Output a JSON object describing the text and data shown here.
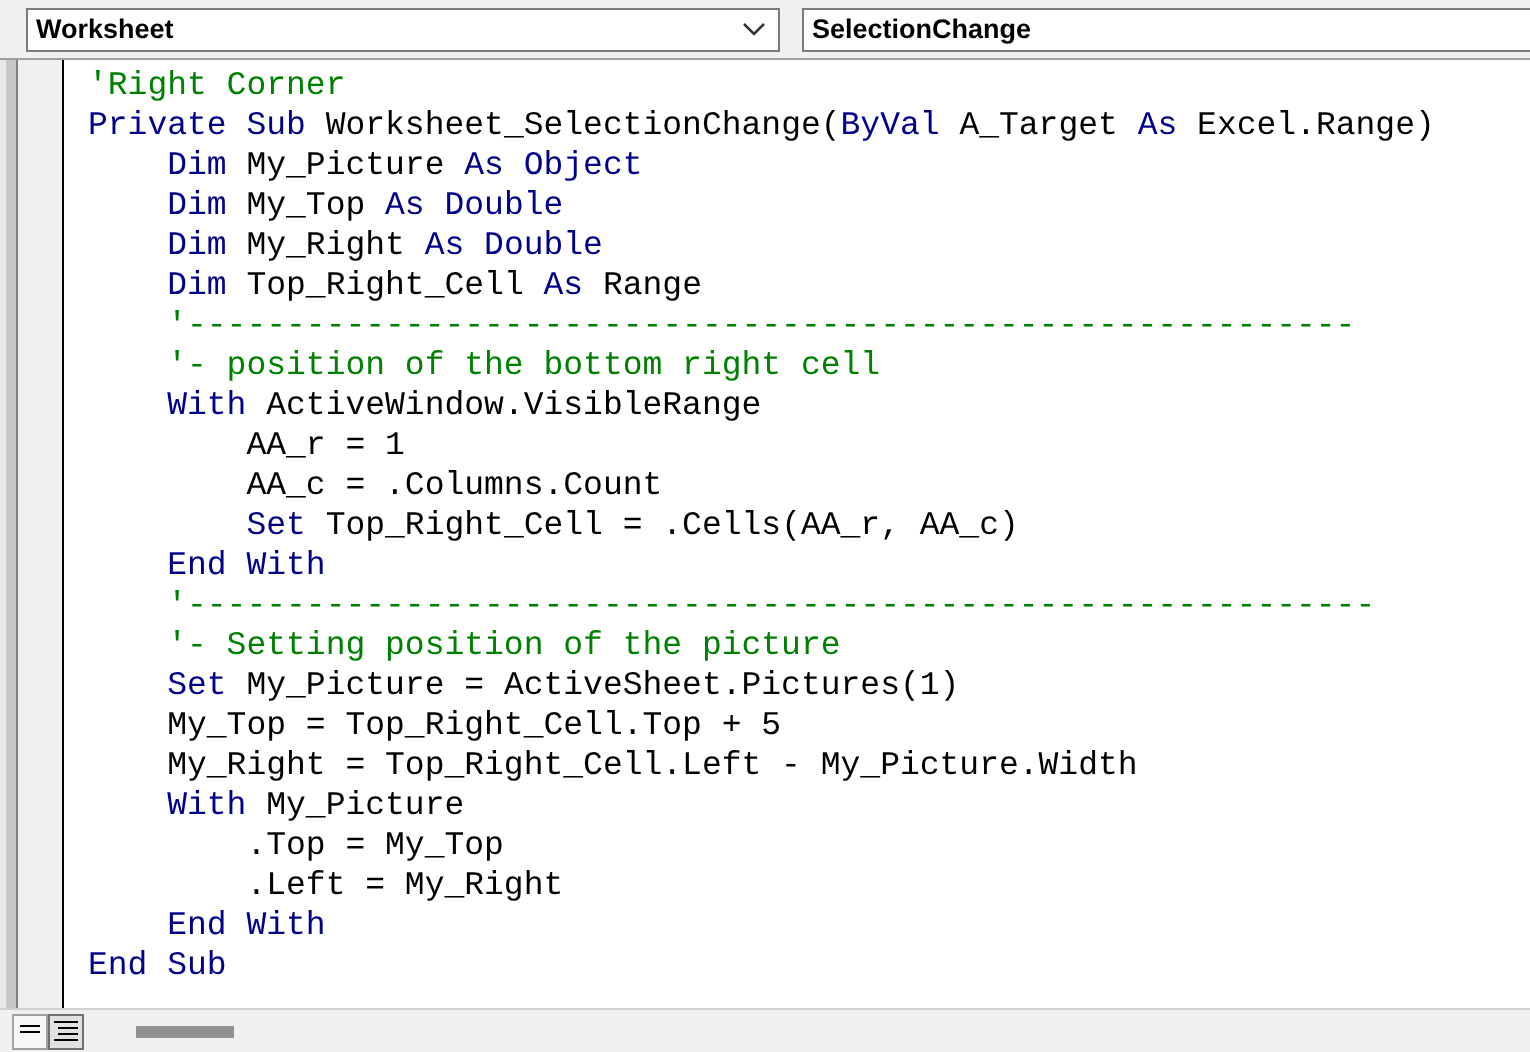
{
  "object_box": {
    "value": "Worksheet"
  },
  "procedure_box": {
    "value": "SelectionChange"
  },
  "code": [
    [
      {
        "kind": "comment",
        "text": "'Right Corner"
      }
    ],
    [
      {
        "kind": "keyword",
        "text": "Private Sub "
      },
      {
        "kind": "plain",
        "text": "Worksheet_SelectionChange("
      },
      {
        "kind": "keyword",
        "text": "ByVal "
      },
      {
        "kind": "plain",
        "text": "A_Target "
      },
      {
        "kind": "keyword",
        "text": "As "
      },
      {
        "kind": "plain",
        "text": "Excel.Range)"
      }
    ],
    [
      {
        "kind": "keyword",
        "text": "    Dim "
      },
      {
        "kind": "plain",
        "text": "My_Picture "
      },
      {
        "kind": "keyword",
        "text": "As Object"
      }
    ],
    [
      {
        "kind": "keyword",
        "text": "    Dim "
      },
      {
        "kind": "plain",
        "text": "My_Top "
      },
      {
        "kind": "keyword",
        "text": "As Double"
      }
    ],
    [
      {
        "kind": "keyword",
        "text": "    Dim "
      },
      {
        "kind": "plain",
        "text": "My_Right "
      },
      {
        "kind": "keyword",
        "text": "As Double"
      }
    ],
    [
      {
        "kind": "keyword",
        "text": "    Dim "
      },
      {
        "kind": "plain",
        "text": "Top_Right_Cell "
      },
      {
        "kind": "keyword",
        "text": "As "
      },
      {
        "kind": "plain",
        "text": "Range"
      }
    ],
    [
      {
        "kind": "comment",
        "text": "    '-----------------------------------------------------------"
      }
    ],
    [
      {
        "kind": "comment",
        "text": "    '- position of the bottom right cell"
      }
    ],
    [
      {
        "kind": "keyword",
        "text": "    With "
      },
      {
        "kind": "plain",
        "text": "ActiveWindow.VisibleRange"
      }
    ],
    [
      {
        "kind": "plain",
        "text": "        AA_r = 1"
      }
    ],
    [
      {
        "kind": "plain",
        "text": "        AA_c = .Columns.Count"
      }
    ],
    [
      {
        "kind": "keyword",
        "text": "        Set "
      },
      {
        "kind": "plain",
        "text": "Top_Right_Cell = .Cells(AA_r, AA_c)"
      }
    ],
    [
      {
        "kind": "keyword",
        "text": "    End With"
      }
    ],
    [
      {
        "kind": "comment",
        "text": "    '------------------------------------------------------------"
      }
    ],
    [
      {
        "kind": "comment",
        "text": "    '- Setting position of the picture"
      }
    ],
    [
      {
        "kind": "keyword",
        "text": "    Set "
      },
      {
        "kind": "plain",
        "text": "My_Picture = ActiveSheet.Pictures(1)"
      }
    ],
    [
      {
        "kind": "plain",
        "text": "    My_Top = Top_Right_Cell.Top + 5"
      }
    ],
    [
      {
        "kind": "plain",
        "text": "    My_Right = Top_Right_Cell.Left - My_Picture.Width"
      }
    ],
    [
      {
        "kind": "keyword",
        "text": "    With "
      },
      {
        "kind": "plain",
        "text": "My_Picture"
      }
    ],
    [
      {
        "kind": "plain",
        "text": "        .Top = My_Top"
      }
    ],
    [
      {
        "kind": "plain",
        "text": "        .Left = My_Right"
      }
    ],
    [
      {
        "kind": "keyword",
        "text": "    End With"
      }
    ],
    [
      {
        "kind": "keyword",
        "text": "End Sub"
      }
    ]
  ]
}
